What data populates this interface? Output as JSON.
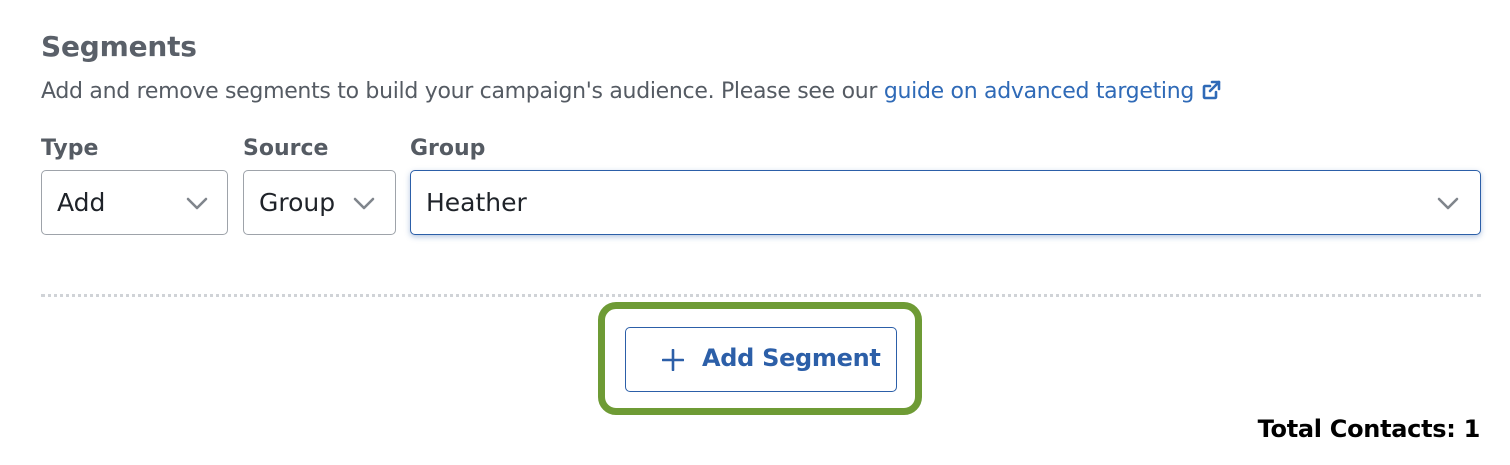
{
  "segments": {
    "title": "Segments",
    "description_prefix": "Add and remove segments to build your campaign's audience. Please see our ",
    "guide_link": "guide on advanced targeting",
    "external_link_icon": "external-link-icon"
  },
  "fields": {
    "type_label": "Type",
    "type_value": "Add",
    "source_label": "Source",
    "source_value": "Group",
    "group_label": "Group",
    "group_value": "Heather",
    "dropdown_icon": "chevron-down-icon"
  },
  "actions": {
    "add_segment_label": "Add Segment",
    "add_icon": "plus-icon"
  },
  "summary": {
    "total_contacts": "Total Contacts: 1"
  },
  "colors": {
    "link": "#2f6ab7",
    "button_accent": "#2c5fa8",
    "highlight_border": "#6e9b35"
  }
}
